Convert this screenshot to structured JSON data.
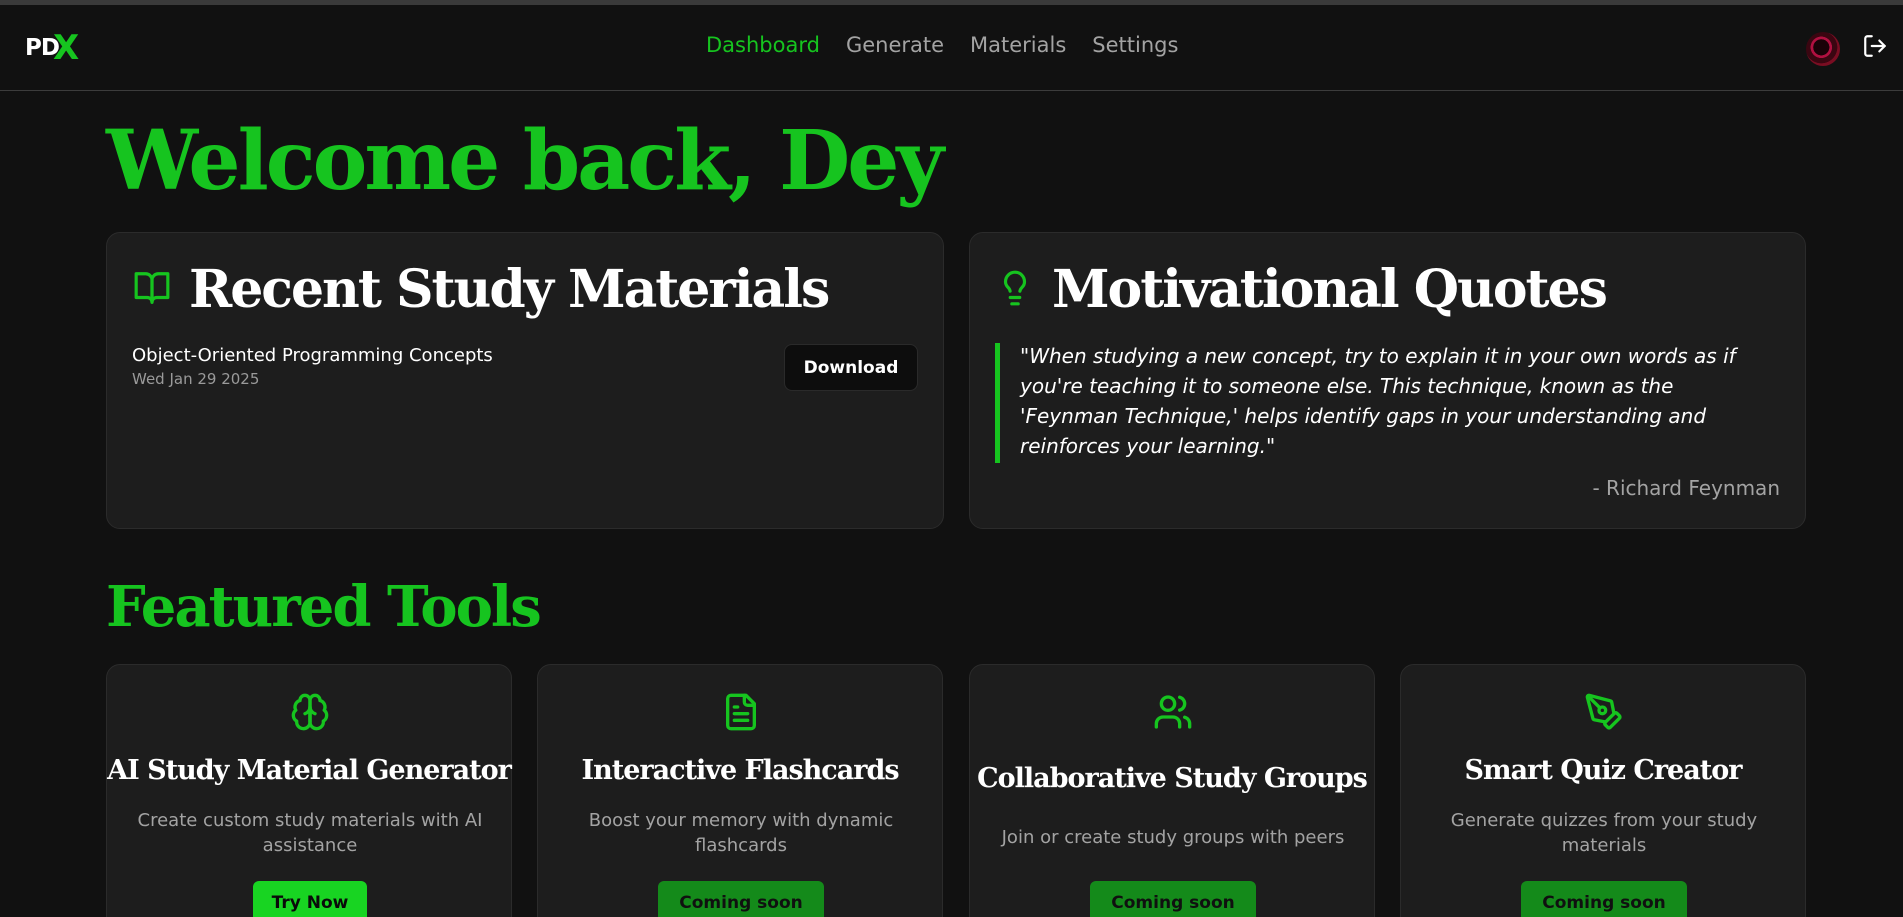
{
  "app": {
    "logo_text": "PD",
    "logo_accent": "X",
    "accent_color": "#16c41f"
  },
  "nav": {
    "items": [
      {
        "label": "Dashboard",
        "active": true
      },
      {
        "label": "Generate",
        "active": false
      },
      {
        "label": "Materials",
        "active": false
      },
      {
        "label": "Settings",
        "active": false
      }
    ],
    "avatar_icon": "user-avatar",
    "logout_icon": "logout-icon"
  },
  "welcome": {
    "title": "Welcome back, Dey"
  },
  "recent": {
    "title": "Recent Study Materials",
    "icon": "book-open-icon",
    "items": [
      {
        "title": "Object-Oriented Programming Concepts",
        "date": "Wed Jan 29 2025",
        "action_label": "Download"
      }
    ]
  },
  "quotes": {
    "title": "Motivational Quotes",
    "icon": "lightbulb-icon",
    "text": "\"When studying a new concept, try to explain it in your own words as if you're teaching it to someone else. This technique, known as the 'Feynman Technique,' helps identify gaps in your understanding and reinforces your learning.\"",
    "author": "- Richard Feynman"
  },
  "featured": {
    "title": "Featured Tools",
    "tools": [
      {
        "icon": "brain-icon",
        "title": "AI Study Material Generator",
        "description": "Create custom study materials with AI assistance",
        "button": "Try Now",
        "available": true
      },
      {
        "icon": "file-text-icon",
        "title": "Interactive Flashcards",
        "description": "Boost your memory with dynamic flashcards",
        "button": "Coming soon",
        "available": false
      },
      {
        "icon": "users-icon",
        "title": "Collaborative Study Groups",
        "description": "Join or create study groups with peers",
        "button": "Coming soon",
        "available": false
      },
      {
        "icon": "pen-tool-icon",
        "title": "Smart Quiz Creator",
        "description": "Generate quizzes from your study materials",
        "button": "Coming soon",
        "available": false
      }
    ]
  }
}
